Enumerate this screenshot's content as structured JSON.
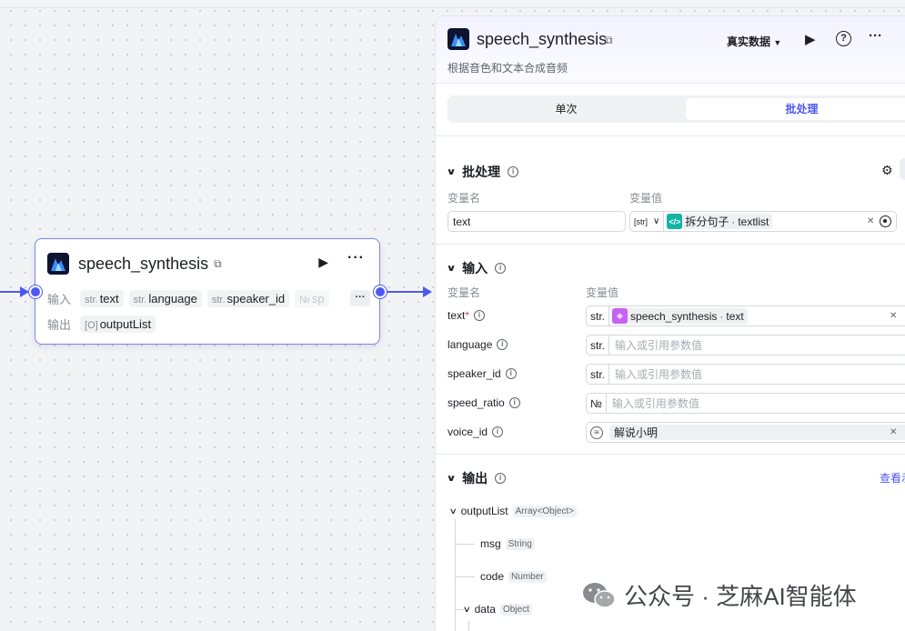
{
  "node": {
    "title": "speech_synthesis",
    "input_label": "输入",
    "output_label": "输出",
    "inputs": [
      {
        "type": "str.",
        "name": "text"
      },
      {
        "type": "str.",
        "name": "language"
      },
      {
        "type": "str.",
        "name": "speaker_id"
      },
      {
        "type": "№",
        "name": "sp"
      }
    ],
    "outputs": [
      {
        "type": "[O]",
        "name": "outputList"
      }
    ],
    "more_label": "···"
  },
  "panel": {
    "title": "speech_synthesis",
    "description": "根据音色和文本合成音频",
    "data_mode": "真实数据",
    "tabs": [
      {
        "label": "单次",
        "active": false
      },
      {
        "label": "批处理",
        "active": true
      }
    ],
    "batch": {
      "title": "批处理",
      "var_name_header": "变量名",
      "var_value_header": "变量值",
      "var_name": "text",
      "type_selector": "[str]",
      "ref_node": "拆分句子",
      "ref_field": "textlist"
    },
    "input": {
      "title": "输入",
      "var_name_header": "变量名",
      "var_value_header": "变量值",
      "params": [
        {
          "name": "text",
          "required": true,
          "type": "str.",
          "ref_node": "speech_synthesis",
          "ref_field": "text",
          "placeholder": ""
        },
        {
          "name": "language",
          "required": false,
          "type": "str.",
          "placeholder": "输入或引用参数值"
        },
        {
          "name": "speaker_id",
          "required": false,
          "type": "str.",
          "placeholder": "输入或引用参数值"
        },
        {
          "name": "speed_ratio",
          "required": false,
          "type": "№",
          "placeholder": "输入或引用参数值"
        },
        {
          "name": "voice_id",
          "required": false,
          "type": "voice",
          "value": "解说小明"
        }
      ]
    },
    "output": {
      "title": "输出",
      "view_link": "查看示",
      "tree": [
        {
          "name": "outputList",
          "type": "Array<Object>"
        },
        {
          "name": "msg",
          "type": "String"
        },
        {
          "name": "code",
          "type": "Number"
        },
        {
          "name": "data",
          "type": "Object"
        }
      ]
    }
  },
  "watermark": {
    "text": "公众号 · 芝麻AI智能体"
  },
  "colors": {
    "accent": "#4e58f0",
    "node_border": "#7c84f5",
    "purple_chip": "#c563f2",
    "teal_chip": "#14b3a6"
  }
}
